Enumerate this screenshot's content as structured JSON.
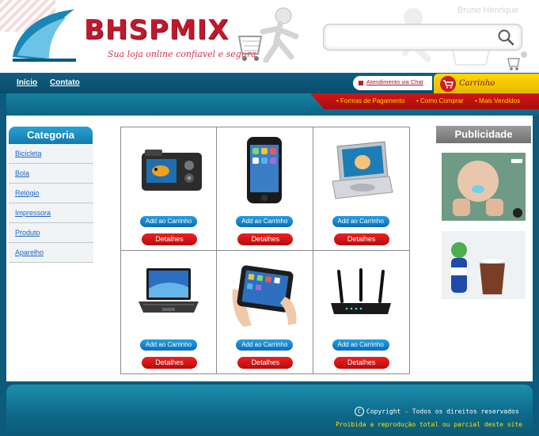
{
  "brand": {
    "logo_text": "BHSPMIX",
    "tagline": "Sua loja online confiavel e segura"
  },
  "header": {
    "user_name": "Bruno Henrique",
    "search_placeholder": "",
    "colors": {
      "brand_red": "#c0182c",
      "teal": "#0d6888",
      "yellow": "#ffd800"
    }
  },
  "nav": {
    "inicio": "Início",
    "contato": "Contato",
    "chat": "Atendimento via Chat",
    "cart": "Carrinho"
  },
  "subnav": {
    "formas": "Formas de Pagamento",
    "como": "Como Comprar",
    "vendidos": "Mais Vendidos"
  },
  "category": {
    "title": "Categoria",
    "items": [
      "Bicicleta",
      "Bola",
      "Relógio",
      "Impressora",
      "Produto",
      "Aparelho"
    ]
  },
  "products": [
    {
      "icon": "digital-camera",
      "add_label": "Add ao Carrinho",
      "details_label": "Detalhes"
    },
    {
      "icon": "smartphone",
      "add_label": "Add ao Carrinho",
      "details_label": "Detalhes"
    },
    {
      "icon": "portable-dvd",
      "add_label": "Add ao Carrinho",
      "details_label": "Detalhes"
    },
    {
      "icon": "laptop",
      "add_label": "Add ao Carrinho",
      "details_label": "Detalhes"
    },
    {
      "icon": "tablet",
      "add_label": "Add ao Carrinho",
      "details_label": "Detalhes"
    },
    {
      "icon": "router",
      "add_label": "Add ao Carrinho",
      "details_label": "Detalhes"
    }
  ],
  "ads": {
    "title": "Publicidade",
    "items": [
      "baby-ad",
      "soda-ad"
    ]
  },
  "footer": {
    "copyright": "Copyright - Todos os direitos reservados",
    "notice": "Proibida a reprodução total ou parcial deste site"
  }
}
